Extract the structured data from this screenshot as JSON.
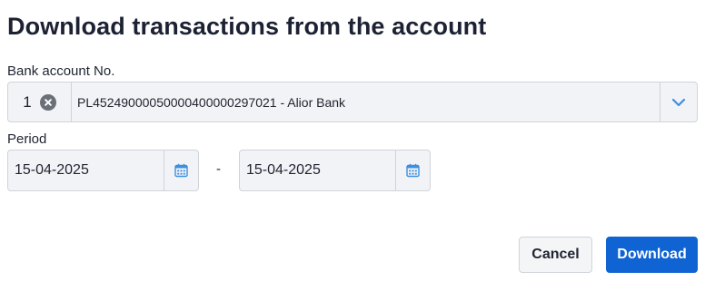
{
  "dialog": {
    "title": "Download transactions from the account"
  },
  "account": {
    "label": "Bank account No.",
    "selected_count": "1",
    "selected_value": "PL45249000050000400000297021 - Alior Bank"
  },
  "period": {
    "label": "Period",
    "from": "15-04-2025",
    "separator": "-",
    "to": "15-04-2025"
  },
  "actions": {
    "cancel_label": "Cancel",
    "download_label": "Download"
  },
  "colors": {
    "accent": "#0f63d2",
    "icon_blue": "#3d8fe0",
    "field_bg": "#f2f3f6",
    "border": "#cfd3da"
  },
  "icons": {
    "clear": "clear-icon",
    "dropdown": "chevron-down-icon",
    "calendar": "calendar-icon"
  }
}
